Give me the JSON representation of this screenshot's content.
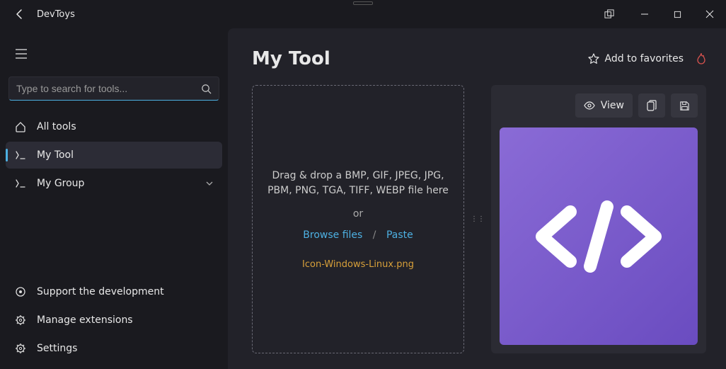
{
  "app": {
    "name": "DevToys"
  },
  "search": {
    "placeholder": "Type to search for tools..."
  },
  "sidebar": {
    "items": [
      {
        "label": "All tools"
      },
      {
        "label": "My Tool"
      },
      {
        "label": "My Group"
      }
    ],
    "bottom": [
      {
        "label": "Support the development"
      },
      {
        "label": "Manage extensions"
      },
      {
        "label": "Settings"
      }
    ]
  },
  "main": {
    "title": "My Tool",
    "favorite_label": "Add to favorites",
    "dropzone": {
      "text": "Drag & drop a BMP, GIF, JPEG, JPG, PBM, PNG, TGA, TIFF, WEBP file here",
      "or": "or",
      "browse": "Browse files",
      "sep": "/",
      "paste": "Paste",
      "filename": "Icon-Windows-Linux.png"
    },
    "toolbar": {
      "view": "View"
    }
  }
}
